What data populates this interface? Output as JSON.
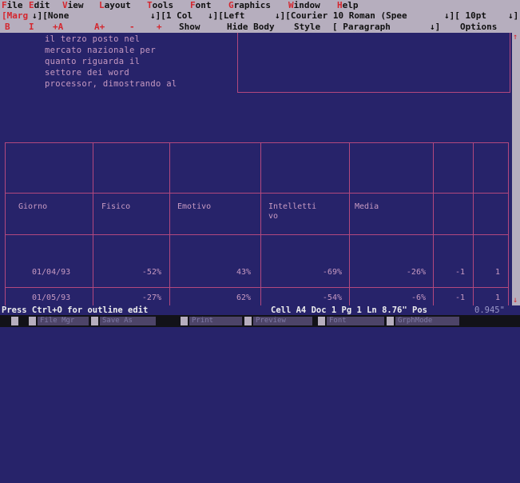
{
  "menu": {
    "items": [
      "File",
      "Edit",
      "View",
      "Layout",
      "Tools",
      "Font",
      "Graphics",
      "Window",
      "Help"
    ]
  },
  "ribbon": {
    "margin_label": "[Marg",
    "margin_value": "↓][None",
    "columns_value": "↓][1 Col",
    "justify_value": "↓][Left",
    "font_value": "↓][Courier 10 Roman (Spee",
    "size_value": "↓][ 10pt",
    "size_end": "↓]"
  },
  "buttonbar": {
    "buttons": [
      "B",
      "I",
      "+A",
      "A+",
      "-",
      "+",
      "Show",
      "Hide Body",
      "Style",
      "[ Paragraph",
      "↓]",
      "Options"
    ]
  },
  "document": {
    "text_lines": [
      "il terzo posto nel",
      "mercato nazionale per",
      "quanto riguarda il",
      "settore dei word",
      "processor, dimostrando al"
    ]
  },
  "table": {
    "headers": [
      "Giorno",
      "Fisico",
      "Emotivo",
      "Intelletti\nvo",
      "Media"
    ],
    "rows": [
      [
        "01/04/93",
        "-52%",
        "43%",
        "-69%",
        "-26%",
        "-1",
        "1"
      ],
      [
        "01/05/93",
        "-27%",
        "62%",
        "-54%",
        "-6%",
        "-1",
        "1"
      ]
    ]
  },
  "status": {
    "message": "Press Ctrl+O for outline edit",
    "location": "Cell A4 Doc 1 Pg 1 Ln 8.76\" Pos",
    "pos_value": "0.945\""
  },
  "function_keys": [
    "File Mgr",
    "Save As",
    "Print",
    "Preview",
    "Font",
    "GrphMode"
  ],
  "colors": {
    "background": "#27236a",
    "bar": "#b6aebe",
    "hotkey": "#d4262e",
    "text": "#c79ac2",
    "grid": "#b2487e"
  }
}
